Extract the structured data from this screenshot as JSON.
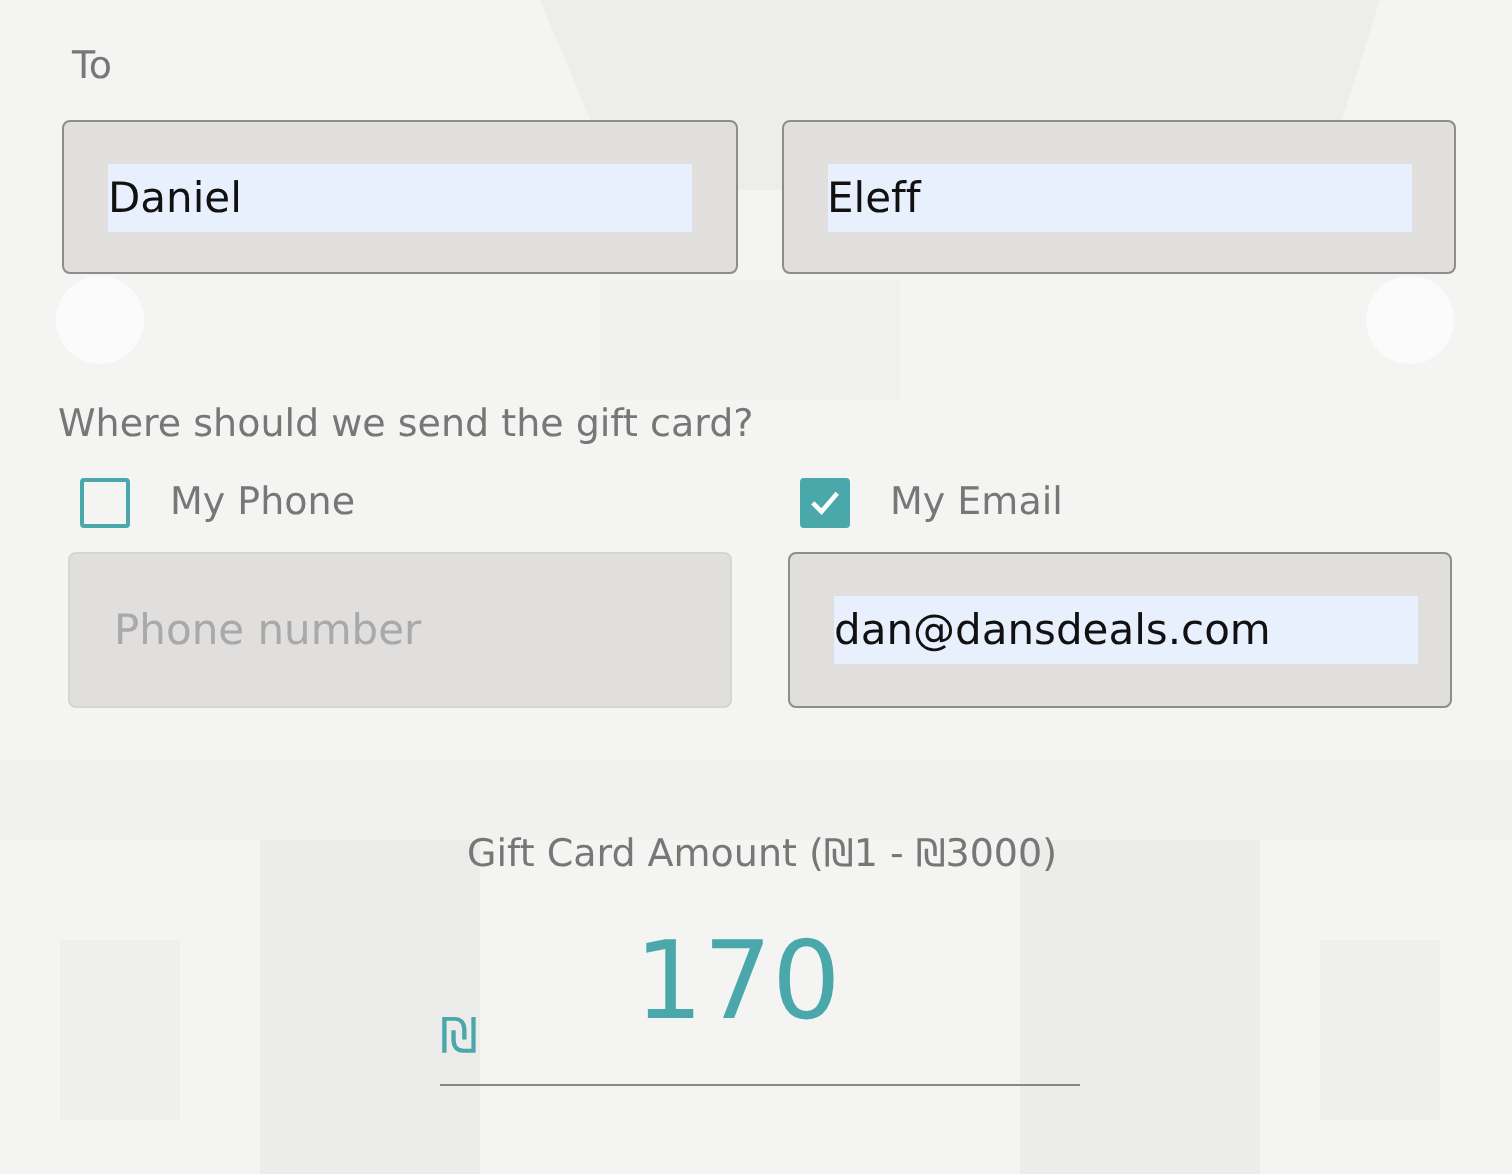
{
  "recipient": {
    "label": "To",
    "fields": [
      {
        "value": "Daniel"
      },
      {
        "value": "Eleff"
      }
    ]
  },
  "delivery": {
    "question": "Where should we send the gift card?",
    "options": [
      {
        "label": "My Phone",
        "checked": false,
        "placeholder": "Phone number",
        "disabled": true
      },
      {
        "label": "My Email",
        "checked": true,
        "value": "dan@dansdeals.com",
        "disabled": false
      }
    ]
  },
  "amount": {
    "label": "Gift Card Amount (₪1 - ₪3000)",
    "currency": "₪",
    "value": "170"
  }
}
